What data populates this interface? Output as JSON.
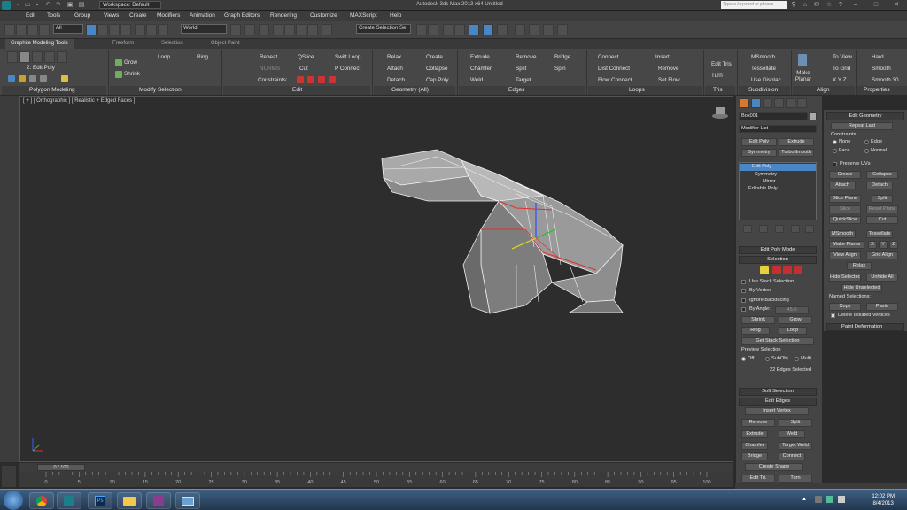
{
  "titlebar": {
    "workspace": "Workspace: Default",
    "title": "Autodesk 3ds Max  2013 x64     Untitled",
    "search_placeholder": "Type a keyword or phrase"
  },
  "menu": [
    "Edit",
    "Tools",
    "Group",
    "Views",
    "Create",
    "Modifiers",
    "Animation",
    "Graph Editors",
    "Rendering",
    "Customize",
    "MAXScript",
    "Help"
  ],
  "maintoolbar": {
    "filter": "All",
    "refcoord": "World",
    "selection_set": "Create Selection Se"
  },
  "ribbon_tabs": [
    "Graphite Modeling Tools",
    "Freeform",
    "Selection",
    "Object Paint"
  ],
  "ribbon": {
    "edit_poly": "2: Edit Poly",
    "grow": "Grow",
    "shrink": "Shrink",
    "loop": "Loop",
    "ring": "Ring",
    "repeat": "Repeat",
    "qslice": "QSlice",
    "swift_loop": "Swift Loop",
    "nurms": "NURMS",
    "cut": "Cut",
    "p_connect": "P Connect",
    "constraints": "Constraints:",
    "relax": "Relax",
    "create": "Create",
    "attach": "Attach",
    "collapse": "Collapse",
    "detach": "Detach",
    "cap_poly": "Cap Poly",
    "extrude": "Extrude",
    "remove": "Remove",
    "bridge": "Bridge",
    "chamfer": "Chamfer",
    "split": "Split",
    "spin": "Spin",
    "weld": "Weld",
    "target": "Target",
    "connect": "Connect",
    "insert": "Insert",
    "dist_connect": "Dist Connect",
    "remove2": "Remove",
    "flow_connect": "Flow Connect",
    "set_flow": "Set Flow",
    "edit_tris": "Edit Tris",
    "turn": "Turn",
    "msmooth": "MSmooth",
    "tessellate": "Tessellate",
    "use_displace": "Use Displac...",
    "make_planar": "Make Planar",
    "to_view": "To View",
    "to_grid": "To Grid",
    "xyz": "X  Y  Z",
    "hard": "Hard",
    "smooth": "Smooth",
    "smooth30": "Smooth 30",
    "groups": [
      "Polygon Modeling",
      "Modify Selection",
      "Edit",
      "Geometry (All)",
      "Edges",
      "Loops",
      "Tris",
      "Subdivision",
      "Align",
      "Properties"
    ]
  },
  "viewport": {
    "label": "[ + ] [ Orthographic ] [ Realistic + Edged Faces ]"
  },
  "command_panel": {
    "object_name": "Box001",
    "modifier_list": "Modifier List",
    "btn_edit_poly": "Edit Poly",
    "btn_extrude": "Extrude",
    "btn_symmetry": "Symmetry",
    "btn_turbosmooth": "TurboSmooth",
    "stack": [
      "Edit Poly",
      "Symmetry",
      "Mirror",
      "Editable Poly"
    ],
    "edit_poly_mode": "Edit Poly Mode",
    "selection": "Selection",
    "use_stack": "Use Stack Selection",
    "by_vertex": "By Vertex",
    "ignore_backfacing": "Ignore Backfacing",
    "by_angle": "By Angle:",
    "by_angle_value": "45.0",
    "shrink": "Shrink",
    "grow": "Grow",
    "ring": "Ring",
    "loop": "Loop",
    "get_stack": "Get Stack Selection",
    "preview_selection": "Preview Selection",
    "off": "Off",
    "subobj": "SubObj",
    "multi": "Multi",
    "edges_selected": "22 Edges Selected",
    "soft_selection": "Soft Selection",
    "edit_edges": "Edit Edges",
    "insert_vertex": "Insert Vertex",
    "remove": "Remove",
    "split": "Split",
    "extrude": "Extrude",
    "weld": "Weld",
    "chamfer": "Chamfer",
    "target_weld": "Target Weld",
    "bridge": "Bridge",
    "connect": "Connect",
    "create_shape": "Create Shape",
    "edit_tri": "Edit Tri.",
    "turn": "Turn"
  },
  "edit_geometry": {
    "header": "Edit Geometry",
    "repeat_last": "Repeat Last",
    "constraints": "Constraints",
    "none": "None",
    "edge": "Edge",
    "face": "Face",
    "normal": "Normal",
    "preserve_uvs": "Preserve UVs",
    "create": "Create",
    "collapse": "Collapse",
    "attach": "Attach",
    "detach": "Detach",
    "slice_plane": "Slice Plane",
    "split": "Split",
    "slice": "Slice",
    "reset_plane": "Reset Plane",
    "quickslice": "QuickSlice",
    "cut": "Cut",
    "msmooth": "MSmooth",
    "tessellate": "Tessellate",
    "make_planar": "Make Planar",
    "x": "X",
    "y": "Y",
    "z": "Z",
    "view_align": "View Align",
    "grid_align": "Grid Align",
    "relax": "Relax",
    "hide_selected": "Hide Selected",
    "unhide_all": "Unhide All",
    "hide_unselected": "Hide Unselected",
    "named_selections": "Named Selections:",
    "copy": "Copy",
    "paste": "Paste",
    "delete_isolated": "Delete Isolated Vertices",
    "paint_deformation": "Paint Deformation"
  },
  "timeline": {
    "frame": "0 / 100",
    "ticks": [
      "0",
      "5",
      "10",
      "15",
      "20",
      "25",
      "30",
      "35",
      "40",
      "45",
      "50",
      "55",
      "60",
      "65",
      "70",
      "75",
      "80",
      "85",
      "90",
      "95",
      "100"
    ]
  },
  "taskbar": {
    "time": "12:02 PM",
    "date": "8/4/2013"
  },
  "colors": {
    "selected_edge": "#e03030",
    "wire": "#e8e8e8",
    "accent": "#4a86c5"
  }
}
